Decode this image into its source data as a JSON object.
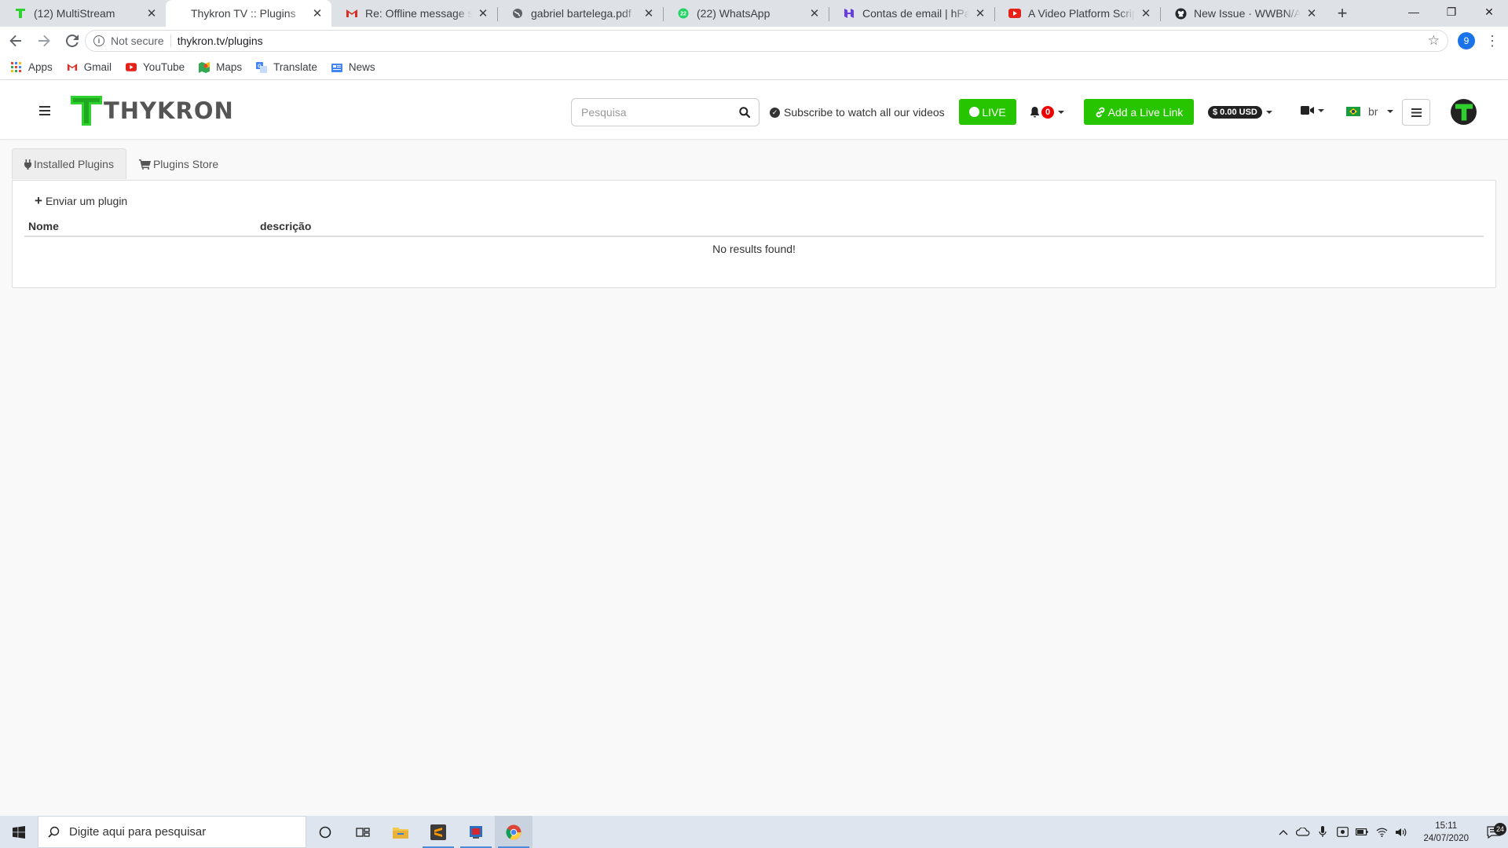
{
  "browser": {
    "tabs": [
      {
        "title": "(12) MultiStream",
        "favicon": "thykron-icon"
      },
      {
        "title": "Thykron TV :: Plugins",
        "favicon": "none",
        "active": true
      },
      {
        "title": "Re: Offline message sent",
        "favicon": "gmail-icon"
      },
      {
        "title": "gabriel bartelega.pdf",
        "favicon": "globe-icon"
      },
      {
        "title": "(22) WhatsApp",
        "favicon": "whatsapp-icon"
      },
      {
        "title": "Contas de email | hPanel",
        "favicon": "hostinger-icon"
      },
      {
        "title": "A Video Platform Script",
        "favicon": "youtube-icon"
      },
      {
        "title": "New Issue · WWBN/AVideo",
        "favicon": "github-icon"
      }
    ],
    "security_label": "Not secure",
    "url": "thykron.tv/plugins",
    "profile_initial": "9",
    "bookmarks": [
      {
        "label": "Apps",
        "icon": "apps-grid-icon"
      },
      {
        "label": "Gmail",
        "icon": "gmail-icon"
      },
      {
        "label": "YouTube",
        "icon": "youtube-icon"
      },
      {
        "label": "Maps",
        "icon": "maps-icon"
      },
      {
        "label": "Translate",
        "icon": "translate-icon"
      },
      {
        "label": "News",
        "icon": "news-icon"
      }
    ]
  },
  "site": {
    "brand": "THYKRON",
    "search_placeholder": "Pesquisa",
    "subscribe_label": "Subscribe to watch all our videos",
    "live_label": "LIVE",
    "notification_count": "0",
    "add_live_link_label": "Add a Live Link",
    "balance": "$ 0.00 USD",
    "language": "br",
    "colors": {
      "accent_green": "#27c500",
      "badge_red": "#e00000"
    }
  },
  "plugins_page": {
    "tabs": [
      {
        "label": "Installed Plugins",
        "icon": "plug-icon",
        "active": true
      },
      {
        "label": "Plugins Store",
        "icon": "cart-icon"
      }
    ],
    "send_plugin_label": "Enviar um plugin",
    "columns": [
      "Nome",
      "descrição"
    ],
    "empty_message": "No results found!"
  },
  "taskbar": {
    "search_placeholder": "Digite aqui para pesquisar",
    "time": "15:11",
    "date": "24/07/2020",
    "notification_count": "24"
  }
}
